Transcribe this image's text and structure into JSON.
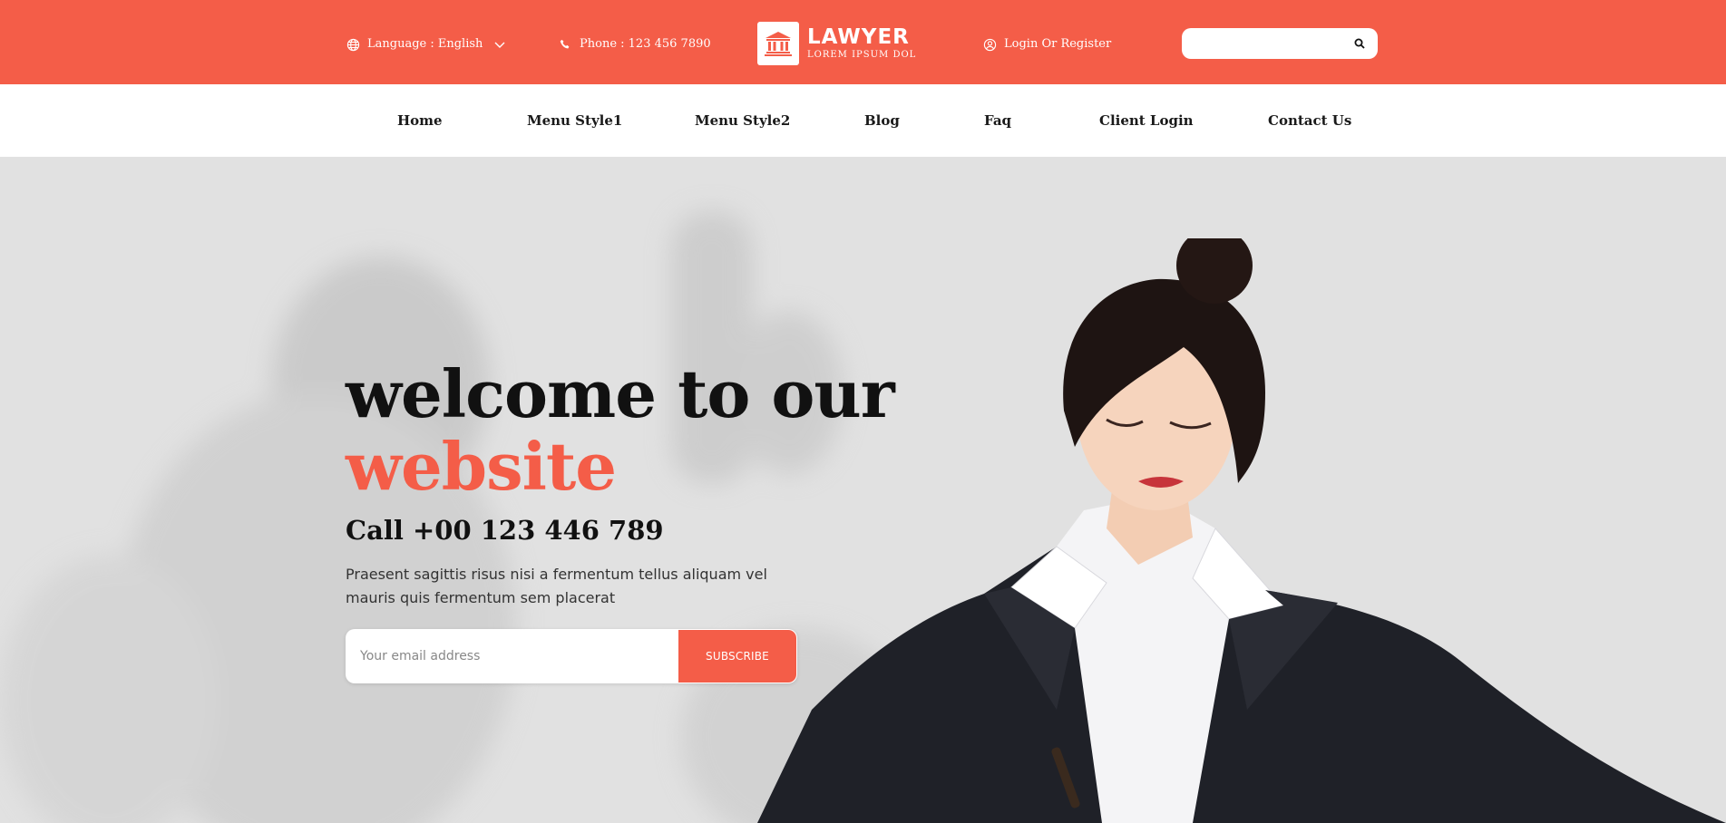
{
  "topbar": {
    "language_label": "Language : English",
    "phone_label": "Phone : 123 456 7890",
    "login_label": "Login Or Register",
    "search_placeholder": "",
    "accent": "#f45d48"
  },
  "logo": {
    "title": "LAWYER",
    "subtitle": "LOREM IPSUM DOL",
    "icon": "courthouse-icon"
  },
  "nav": {
    "items": [
      {
        "label": "Home"
      },
      {
        "label": "Menu Style1"
      },
      {
        "label": "Menu Style2"
      },
      {
        "label": "Blog"
      },
      {
        "label": "Faq"
      },
      {
        "label": "Client Login"
      },
      {
        "label": "Contact Us"
      }
    ]
  },
  "hero": {
    "title_line1": "welcome to our",
    "title_line2": "website",
    "call": "Call +00 123 446 789",
    "description": "Praesent sagittis risus nisi a fermentum tellus aliquam vel mauris quis fermentum sem placerat",
    "email_placeholder": "Your email address",
    "subscribe_label": "SUBSCRIBE",
    "highlight_color": "#f45d48"
  }
}
